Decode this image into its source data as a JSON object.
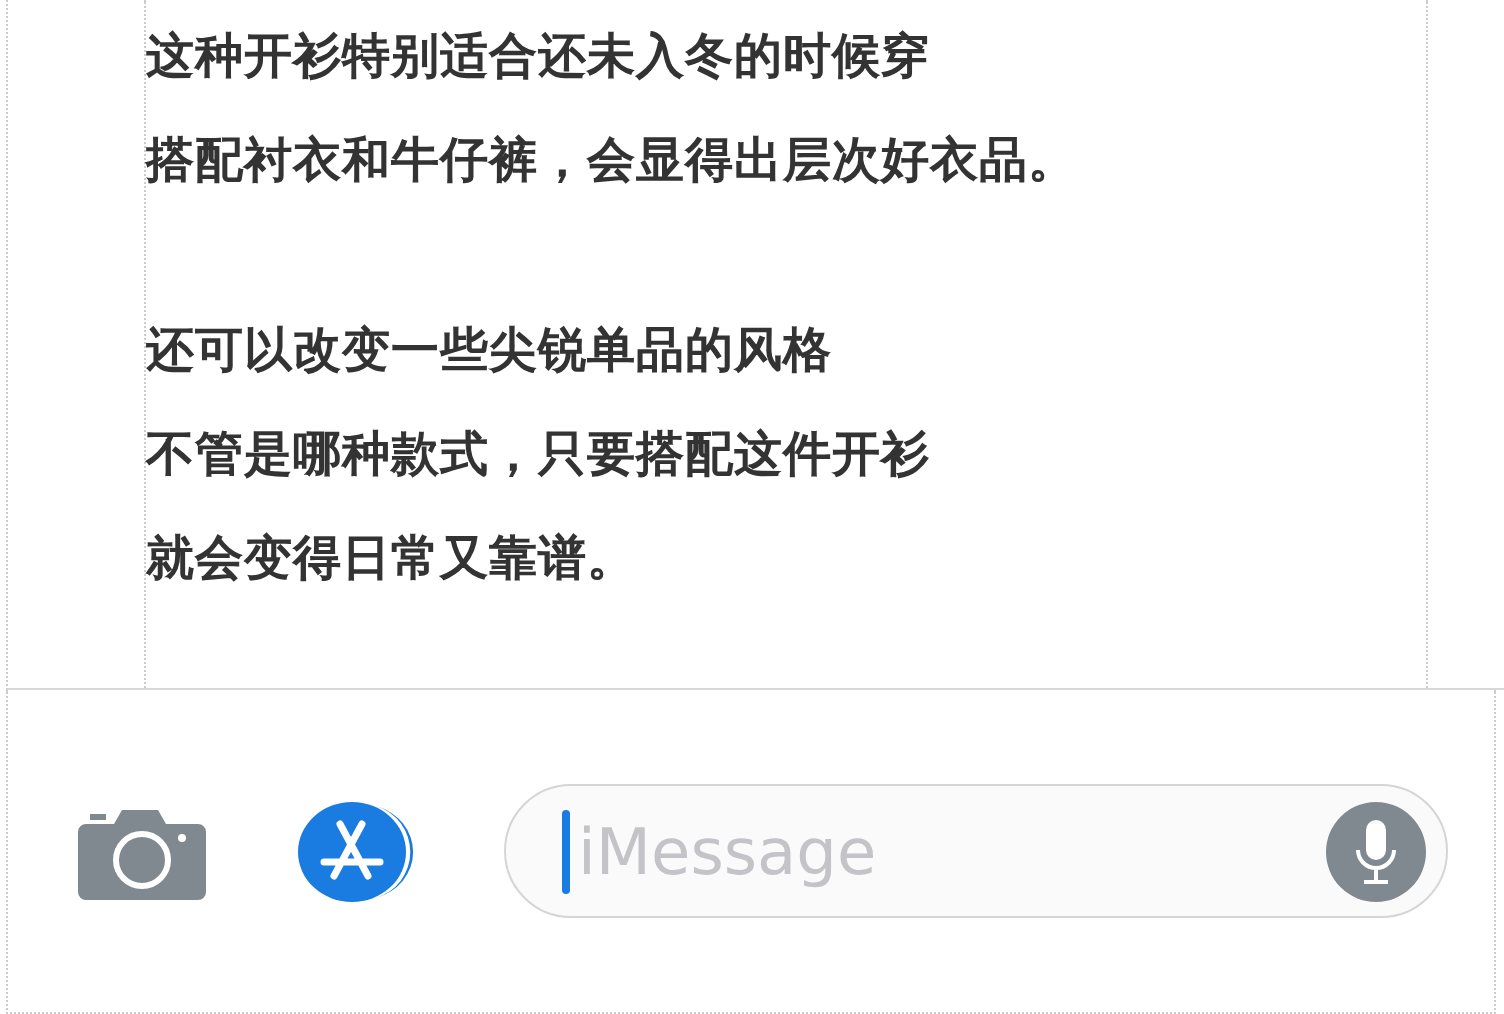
{
  "article": {
    "paragraphs": [
      [
        "这种开衫特别适合还未入冬的时候穿",
        "搭配衬衣和牛仔裤，会显得出层次好衣品。"
      ],
      [
        "还可以改变一些尖锐单品的风格",
        "不管是哪种款式，只要搭配这件开衫",
        "就会变得日常又靠谱。"
      ]
    ]
  },
  "composer": {
    "placeholder": "iMessage",
    "focused": true
  }
}
